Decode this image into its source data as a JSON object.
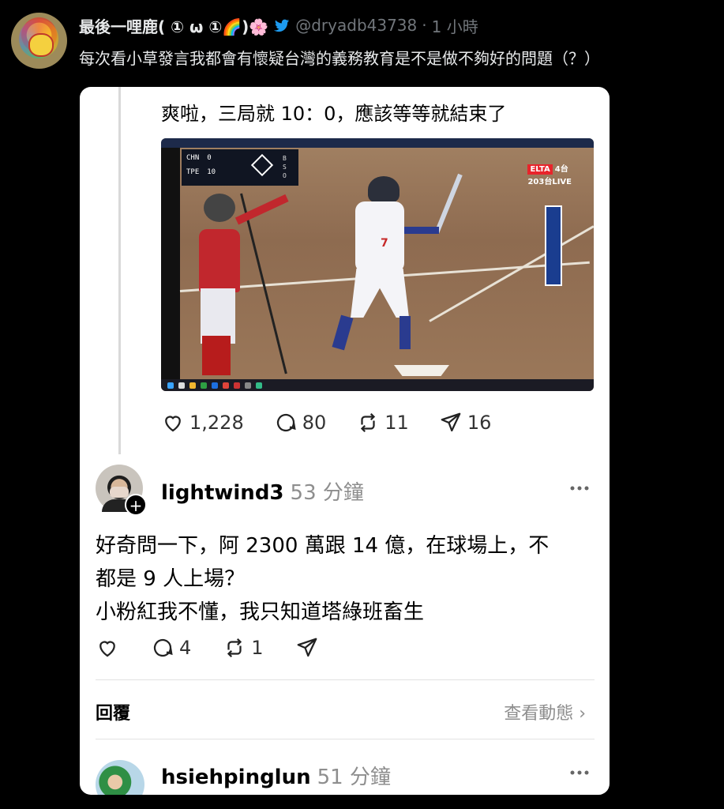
{
  "outer_tweet": {
    "display_name": "最後一哩鹿( ① ω ①🌈)🌸",
    "handle": "@dryadb43738",
    "separator": "·",
    "time": "1 小時",
    "text": "每次看小草發言我都會有懷疑台灣的義務教育是不是做不夠好的問題（？）"
  },
  "threads_card": {
    "post_text": "爽啦，三局就 10：0，應該等等就結束了",
    "video": {
      "scoreboard": [
        {
          "team": "CHN",
          "score": "0"
        },
        {
          "team": "TPE",
          "score": "10"
        }
      ],
      "bso": [
        "B",
        "S",
        "O"
      ],
      "broadcast_logo": "ELTA",
      "channel": "4台",
      "channel_sub": "203台LIVE",
      "batter_number": "7"
    },
    "stats": {
      "likes": "1,228",
      "comments": "80",
      "reposts": "11",
      "shares": "16"
    },
    "comment": {
      "username": "lightwind3",
      "time": "53 分鐘",
      "follow_badge": "+",
      "lines": [
        "好奇問一下，阿 2300 萬跟 14 億，在球場上，不",
        "都是 9 人上場？",
        "小粉紅我不懂，我只知道塔綠班畜生"
      ],
      "comments": "4",
      "reposts": "1"
    },
    "reply_label": "回覆",
    "view_activity": "查看動態 ›",
    "next_comment": {
      "username": "hsiehpinglun",
      "time": "51 分鐘"
    }
  },
  "colors": {
    "background": "#000000",
    "card": "#ffffff",
    "muted": "#8e8e8e",
    "handle": "#71767b",
    "twitter_blue": "#1d9bf0"
  },
  "icons": [
    "heart-icon",
    "comment-icon",
    "repost-icon",
    "share-icon",
    "more-icon",
    "twitter-bird-icon"
  ]
}
